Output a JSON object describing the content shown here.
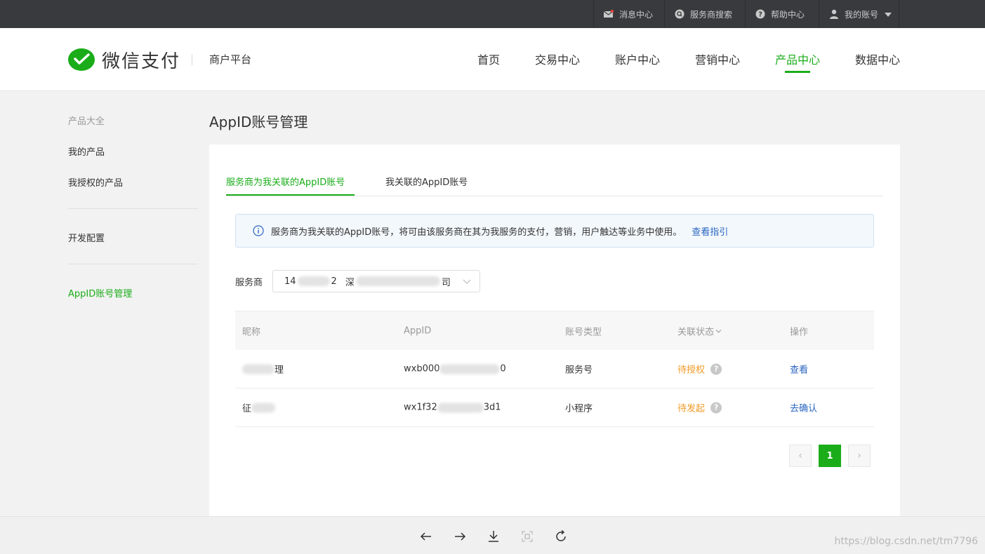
{
  "topbar": {
    "messages": "消息中心",
    "service_search": "服务商搜索",
    "help": "帮助中心",
    "account": "我的账号"
  },
  "header": {
    "logo_text": "微信支付",
    "platform": "商户平台",
    "nav": [
      "首页",
      "交易中心",
      "账户中心",
      "营销中心",
      "产品中心",
      "数据中心"
    ],
    "active_nav": "产品中心"
  },
  "sidebar": {
    "title": "产品大全",
    "items": [
      "我的产品",
      "我授权的产品",
      "开发配置",
      "AppID账号管理"
    ],
    "active": "AppID账号管理"
  },
  "main": {
    "title": "AppID账号管理",
    "tabs": [
      "服务商为我关联的AppID账号",
      "我关联的AppID账号"
    ],
    "notice_text": "服务商为我关联的AppID账号，将可由该服务商在其为我服务的支付，营销，用户触达等业务中使用。",
    "notice_link": "查看指引",
    "service_label": "服务商",
    "service_value_prefix": "14",
    "service_value_mid": "2",
    "service_value_a": "深",
    "service_value_suffix": "司",
    "table": {
      "headers": [
        "昵称",
        "AppID",
        "账号类型",
        "关联状态",
        "操作"
      ],
      "rows": [
        {
          "nick_end": "理",
          "appid_start": "wxb000",
          "appid_end": "0",
          "type": "服务号",
          "status": "待授权",
          "op": "查看"
        },
        {
          "nick_start": "征",
          "appid_start": "wx1f32",
          "appid_end": "3d1",
          "type": "小程序",
          "status": "待发起",
          "op": "去确认"
        }
      ]
    },
    "pagination": {
      "prev": "‹",
      "current": "1",
      "next": "›"
    }
  },
  "watermark": "https://blog.csdn.net/tm7796",
  "colors": {
    "brand_green": "#1aad19",
    "link_blue": "#2b66c0",
    "status_orange": "#f09a24",
    "topbar": "#393a3e"
  }
}
